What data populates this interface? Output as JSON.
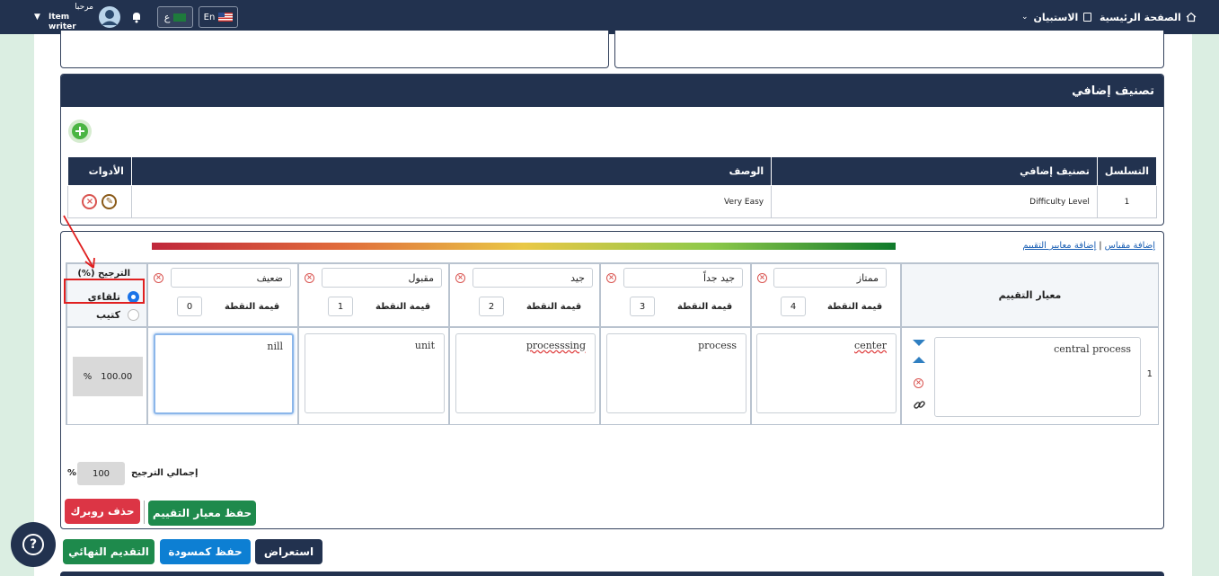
{
  "topbar": {
    "user_greeting": "مرحبا",
    "user_role": "Item writer",
    "lang_ar_label": "ع",
    "lang_en_label": "En",
    "home_label": "الصفحة الرئيسية",
    "survey_label": "الاستبيان"
  },
  "classification": {
    "title": "تصنيف إضافي",
    "columns": [
      "التسلسل",
      "تصنيف إضافي",
      "الوصف",
      "الأدوات"
    ],
    "rows": [
      {
        "seq": "1",
        "category": "Difficulty Level",
        "description": "Very Easy"
      }
    ]
  },
  "rubric": {
    "links": {
      "add_scale": "إضافة مقياس",
      "separator": "|",
      "add_criteria": "إضافة معايير التقييم"
    },
    "criteria_header": "معيار التقييم",
    "weight_header": "(%) الترجيح",
    "weight_auto": "تلقاءي",
    "weight_writer": "كتيب",
    "point_value_label": "قيمة النقطة",
    "levels": [
      {
        "name": "ممتاز",
        "points": "4"
      },
      {
        "name": "جيد جداً",
        "points": "3"
      },
      {
        "name": "جيد",
        "points": "2"
      },
      {
        "name": "مقبول",
        "points": "1"
      },
      {
        "name": "ضعيف",
        "points": "0"
      }
    ],
    "rows": [
      {
        "index": "1",
        "criterion": "central process",
        "descriptors": [
          "center",
          "process",
          "processsing",
          "unit",
          "nill"
        ],
        "weight": "100.00",
        "weight_unit": "%"
      }
    ],
    "total_weight_label": "إجمالي الترجيح",
    "total_weight_value": "100",
    "total_weight_unit": "%"
  },
  "buttons": {
    "save_criteria": "حفظ معيار التقييم",
    "delete_rubric": "حذف روبرك",
    "final_submit": "التقديم النهائي",
    "save_draft": "حفظ كمسودة",
    "preview": "استعراض"
  },
  "colors": {
    "navy": "#22324f",
    "green": "#1e8a4c",
    "red": "#dc3545",
    "blue": "#0d7fd3",
    "annotation": "#e02020"
  }
}
